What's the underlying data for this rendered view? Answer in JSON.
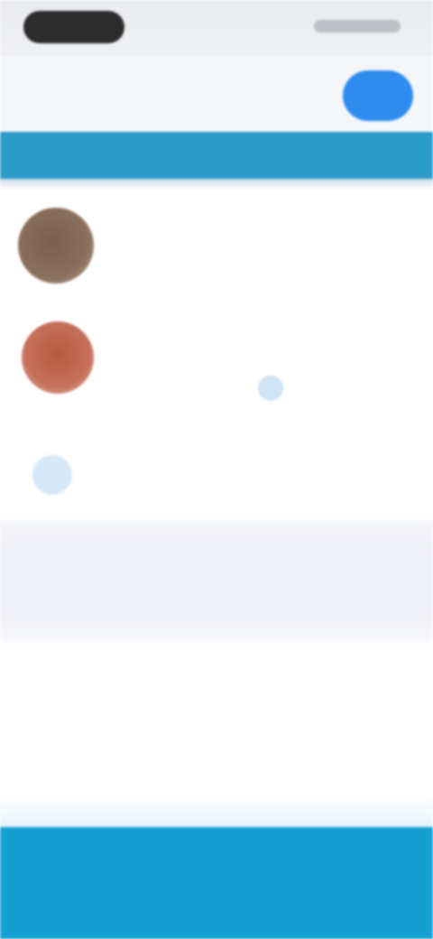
{
  "header": {
    "title": "",
    "mid_text": "",
    "action_label": ""
  },
  "tabs": [
    {
      "label": ""
    },
    {
      "label": ""
    },
    {
      "label": ""
    },
    {
      "label": ""
    }
  ],
  "list": [
    {
      "name": "",
      "subtitle": ""
    },
    {
      "name": "",
      "action_link": "",
      "action_right": ""
    }
  ],
  "add_row": {
    "label": ""
  },
  "summary": {
    "left": "",
    "right": ""
  },
  "bottom_button": {
    "label": ""
  },
  "colors": {
    "accent": "#2b9bc9",
    "button_blue": "#2f8df0",
    "bottom_bar": "#139fd2"
  }
}
